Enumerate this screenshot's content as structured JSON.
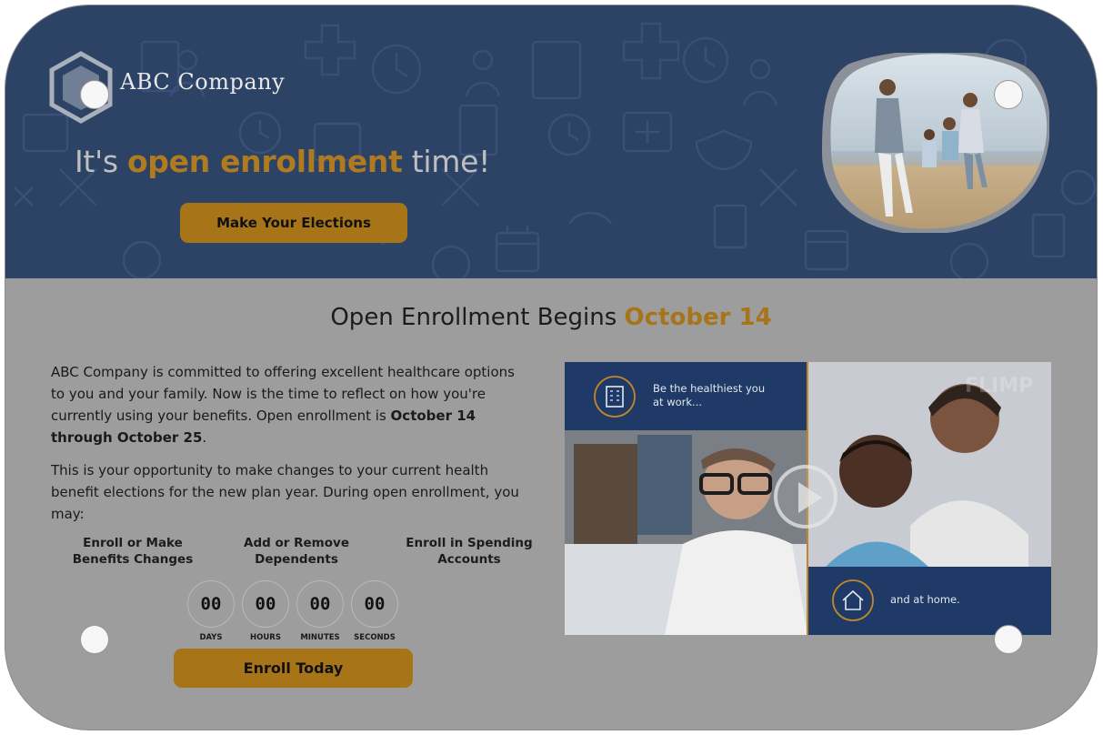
{
  "brand": {
    "name": "ABC Company"
  },
  "hero": {
    "headline_pre": "It's ",
    "headline_accent": "open enrollment",
    "headline_post": " time!",
    "cta_label": "Make Your Elections"
  },
  "section": {
    "title_pre": "Open Enrollment Begins ",
    "title_accent": "October 14"
  },
  "intro": {
    "p1_text": "ABC Company is committed to offering excellent healthcare options to you and your family. Now is the time to reflect on how you're currently using your benefits. Open enrollment is ",
    "p1_bold": "October 14 through October 25",
    "p1_end": ".",
    "p2_text": "This is your opportunity to make changes to your current health benefit elections for the new plan year. During open enrollment, you may:"
  },
  "options": [
    {
      "line1": "Enroll or Make",
      "line2": "Benefits Changes"
    },
    {
      "line1": "Add or Remove",
      "line2": "Dependents"
    },
    {
      "line1": "Enroll in Spending",
      "line2": "Accounts"
    }
  ],
  "countdown": [
    {
      "value": "00",
      "label": "DAYS"
    },
    {
      "value": "00",
      "label": "HOURS"
    },
    {
      "value": "00",
      "label": "MINUTES"
    },
    {
      "value": "00",
      "label": "SECONDS"
    }
  ],
  "enroll_cta": "Enroll Today",
  "video": {
    "caption1_l1": "Be the healthiest you",
    "caption1_l2": "at work...",
    "caption2": "and at home.",
    "watermark": "FLIMP",
    "play_icon": "play-icon"
  },
  "colors": {
    "navy": "#2c4366",
    "gold": "#a87418",
    "gray": "#9d9d9d"
  }
}
